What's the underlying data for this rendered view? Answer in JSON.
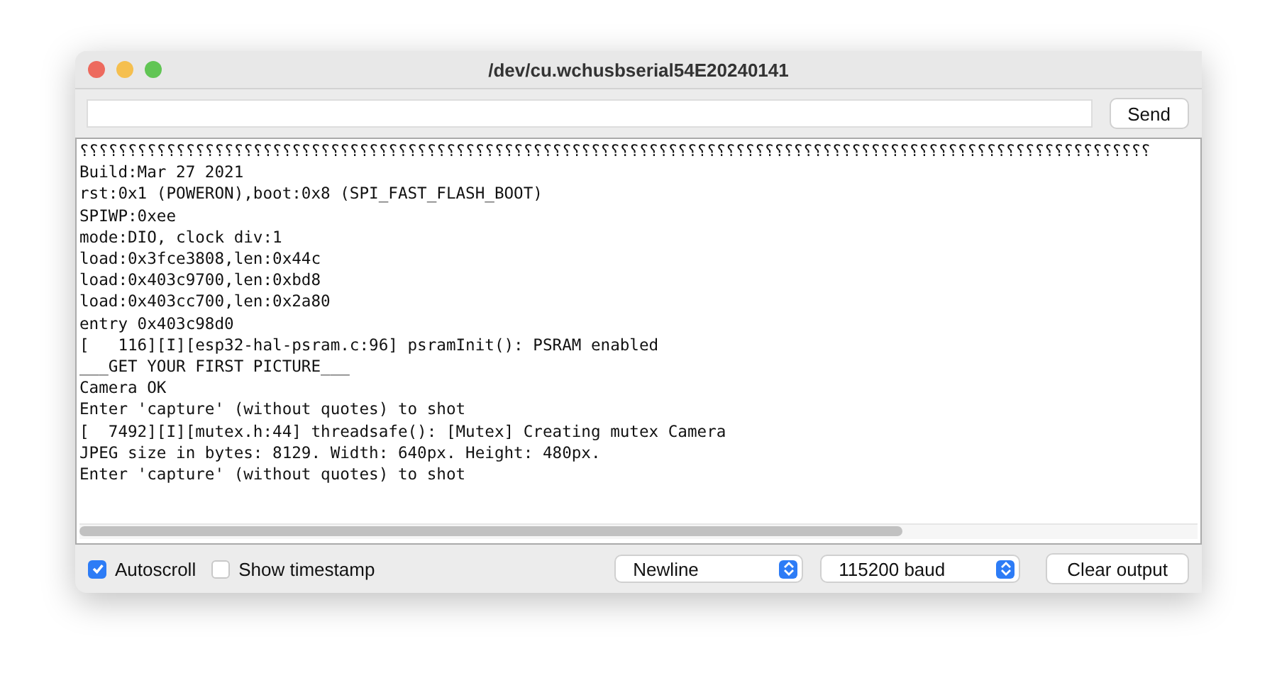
{
  "window": {
    "title": "/dev/cu.wchusbserial54E20240141"
  },
  "send_button": {
    "label": "Send"
  },
  "output_lines": [
    "⸮⸮⸮⸮⸮⸮⸮⸮⸮⸮⸮⸮⸮⸮⸮⸮⸮⸮⸮⸮⸮⸮⸮⸮⸮⸮⸮⸮⸮⸮⸮⸮⸮⸮⸮⸮⸮⸮⸮⸮⸮⸮⸮⸮⸮⸮⸮⸮⸮⸮⸮⸮⸮⸮⸮⸮⸮⸮⸮⸮⸮⸮⸮⸮⸮⸮⸮⸮⸮⸮⸮⸮⸮⸮⸮⸮⸮⸮⸮⸮⸮⸮⸮⸮⸮⸮⸮⸮⸮⸮⸮⸮⸮⸮⸮⸮⸮⸮⸮⸮⸮⸮⸮⸮⸮⸮⸮⸮⸮⸮⸮",
    "Build:Mar 27 2021",
    "rst:0x1 (POWERON),boot:0x8 (SPI_FAST_FLASH_BOOT)",
    "SPIWP:0xee",
    "mode:DIO, clock div:1",
    "load:0x3fce3808,len:0x44c",
    "load:0x403c9700,len:0xbd8",
    "load:0x403cc700,len:0x2a80",
    "entry 0x403c98d0",
    "[   116][I][esp32-hal-psram.c:96] psramInit(): PSRAM enabled",
    "___GET YOUR FIRST PICTURE___",
    "Camera OK",
    "Enter 'capture' (without quotes) to shot",
    "[  7492][I][mutex.h:44] threadsafe(): [Mutex] Creating mutex Camera",
    "JPEG size in bytes: 8129. Width: 640px. Height: 480px.",
    "Enter 'capture' (without quotes) to shot"
  ],
  "options": [
    {
      "label": "Autoscroll",
      "checked": true
    },
    {
      "label": "Show timestamp",
      "checked": false
    }
  ],
  "line_ending": {
    "value": "Newline"
  },
  "baud_rate": {
    "value": "115200 baud"
  },
  "clear_button": {
    "label": "Clear output"
  }
}
